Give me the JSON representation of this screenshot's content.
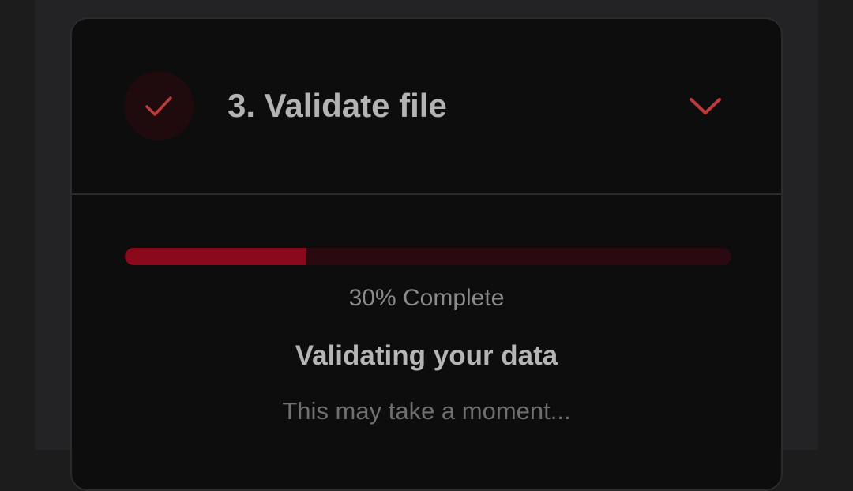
{
  "step": {
    "title": "3. Validate file",
    "status_icon": "check-icon",
    "toggle_icon": "chevron-down-icon"
  },
  "progress": {
    "percent": 30,
    "label": "30% Complete"
  },
  "status": {
    "title": "Validating your data",
    "subtitle": "This may take a moment..."
  },
  "colors": {
    "accent": "#c0393b",
    "progress_fill": "#8a0a1b",
    "progress_track": "#2b0911",
    "card_background": "#0d0d0d",
    "page_background": "#1c1c1d"
  }
}
